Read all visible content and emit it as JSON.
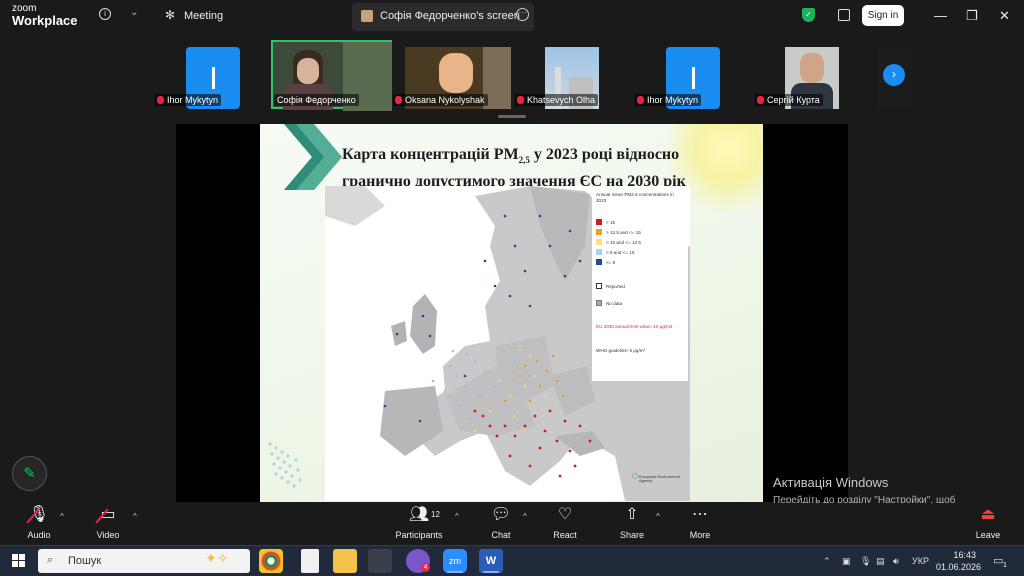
{
  "app": {
    "logo_top": "zoom",
    "logo_bottom": "Workplace",
    "meeting_label": "Meeting",
    "sign_in": "Sign in"
  },
  "share_tab": {
    "label": "Софія Федорченко's screen"
  },
  "participants": [
    {
      "name": "Ihor Mykytyn",
      "type": "avatar"
    },
    {
      "name": "Софія Федорченко",
      "type": "video",
      "active": true
    },
    {
      "name": "Oksana Nykolyshak",
      "type": "video"
    },
    {
      "name": "Khatsevych Olha",
      "type": "video"
    },
    {
      "name": "Ihor Mykytyn",
      "type": "avatar"
    },
    {
      "name": "Сергій Курта",
      "type": "video"
    }
  ],
  "slide": {
    "title_part1": "Карта концентрацій PM",
    "title_sub": "2,5",
    "title_part2": " у 2023 році відносно",
    "title_line2": "гранично допустимого значення ЄС на 2030 рік"
  },
  "map_legend": {
    "title": "Annual mean PM2.5 concentrations in 2023",
    "items": [
      {
        "label": "> 15",
        "color": "#c81e1e"
      },
      {
        "label": "> 12.5 and <= 15",
        "color": "#f0a21e"
      },
      {
        "label": "> 10 and <= 12.5",
        "color": "#f7e17a"
      },
      {
        "label": "> 5 and <= 10",
        "color": "#a9d3f0"
      },
      {
        "label": "<= 5",
        "color": "#1b4f8c"
      }
    ],
    "reported": "Reported",
    "no_data": "No data",
    "eu_limit": "EU 2030 annual limit value: 10 μg/m3",
    "who_guideline": "WHO guideline: 5 μg/m³",
    "agency": "European Environment Agency"
  },
  "watermark": {
    "line1": "Активація Windows",
    "line2": "Перейдіть до розділу \"Настройки\", щоб активувати Windows."
  },
  "toolbar": {
    "audio": "Audio",
    "video": "Video",
    "participants": "Participants",
    "participants_count": "12",
    "chat": "Chat",
    "react": "React",
    "share": "Share",
    "more": "More",
    "leave": "Leave"
  },
  "taskbar": {
    "search_placeholder": "Пошук",
    "viber_badge": "4",
    "lang": "УКР",
    "time": "16:43",
    "date": "01.06.2026",
    "notifications": "1"
  }
}
